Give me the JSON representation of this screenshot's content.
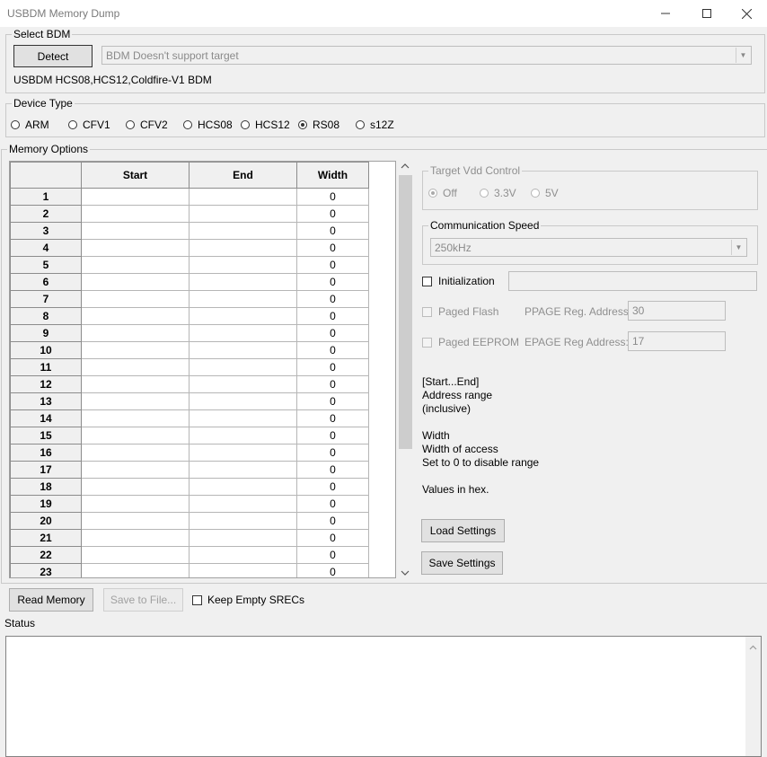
{
  "window": {
    "title": "USBDM Memory Dump",
    "minimize": "—",
    "maximize": "☐",
    "close": "✕"
  },
  "select_bdm": {
    "legend": "Select BDM",
    "detect_label": "Detect",
    "bdm_combo_value": "BDM Doesn't support target",
    "bdm_info": "USBDM HCS08,HCS12,Coldfire-V1 BDM"
  },
  "device_type": {
    "legend": "Device Type",
    "options": [
      "ARM",
      "CFV1",
      "CFV2",
      "HCS08",
      "HCS12",
      "RS08",
      "s12Z"
    ],
    "selected": "RS08"
  },
  "memory_options": {
    "legend": "Memory Options",
    "columns": [
      "",
      "Start",
      "End",
      "Width"
    ],
    "rows": [
      {
        "n": "1",
        "start": "",
        "end": "",
        "width": "0"
      },
      {
        "n": "2",
        "start": "",
        "end": "",
        "width": "0"
      },
      {
        "n": "3",
        "start": "",
        "end": "",
        "width": "0"
      },
      {
        "n": "4",
        "start": "",
        "end": "",
        "width": "0"
      },
      {
        "n": "5",
        "start": "",
        "end": "",
        "width": "0"
      },
      {
        "n": "6",
        "start": "",
        "end": "",
        "width": "0"
      },
      {
        "n": "7",
        "start": "",
        "end": "",
        "width": "0"
      },
      {
        "n": "8",
        "start": "",
        "end": "",
        "width": "0"
      },
      {
        "n": "9",
        "start": "",
        "end": "",
        "width": "0"
      },
      {
        "n": "10",
        "start": "",
        "end": "",
        "width": "0"
      },
      {
        "n": "11",
        "start": "",
        "end": "",
        "width": "0"
      },
      {
        "n": "12",
        "start": "",
        "end": "",
        "width": "0"
      },
      {
        "n": "13",
        "start": "",
        "end": "",
        "width": "0"
      },
      {
        "n": "14",
        "start": "",
        "end": "",
        "width": "0"
      },
      {
        "n": "15",
        "start": "",
        "end": "",
        "width": "0"
      },
      {
        "n": "16",
        "start": "",
        "end": "",
        "width": "0"
      },
      {
        "n": "17",
        "start": "",
        "end": "",
        "width": "0"
      },
      {
        "n": "18",
        "start": "",
        "end": "",
        "width": "0"
      },
      {
        "n": "19",
        "start": "",
        "end": "",
        "width": "0"
      },
      {
        "n": "20",
        "start": "",
        "end": "",
        "width": "0"
      },
      {
        "n": "21",
        "start": "",
        "end": "",
        "width": "0"
      },
      {
        "n": "22",
        "start": "",
        "end": "",
        "width": "0"
      },
      {
        "n": "23",
        "start": "",
        "end": "",
        "width": "0"
      }
    ]
  },
  "target_vdd": {
    "legend": "Target Vdd Control",
    "options": [
      "Off",
      "3.3V",
      "5V"
    ],
    "selected": "Off"
  },
  "comm_speed": {
    "legend": "Communication Speed",
    "value": "250kHz"
  },
  "initialization": {
    "label": "Initialization",
    "value": ""
  },
  "paged_flash": {
    "label": "Paged Flash",
    "reg_label": "PPAGE Reg. Address:",
    "reg_value": "30"
  },
  "paged_eeprom": {
    "label": "Paged EEPROM",
    "reg_label": "EPAGE Reg Address:",
    "reg_value": "17"
  },
  "help": {
    "line1": "[Start...End]",
    "line2": "Address range",
    "line3": "(inclusive)",
    "line4": "Width",
    "line5": "Width of access",
    "line6": "Set to 0 to disable range",
    "line7": "Values in hex."
  },
  "buttons": {
    "load_settings": "Load Settings",
    "save_settings": "Save Settings",
    "read_memory": "Read Memory",
    "save_to_file": "Save to File...",
    "keep_empty": "Keep Empty SRECs"
  },
  "status": {
    "label": "Status",
    "text": ""
  },
  "icons": {
    "scroll_up": "▲",
    "scroll_down": "▼",
    "combo_arrow": "▼"
  }
}
